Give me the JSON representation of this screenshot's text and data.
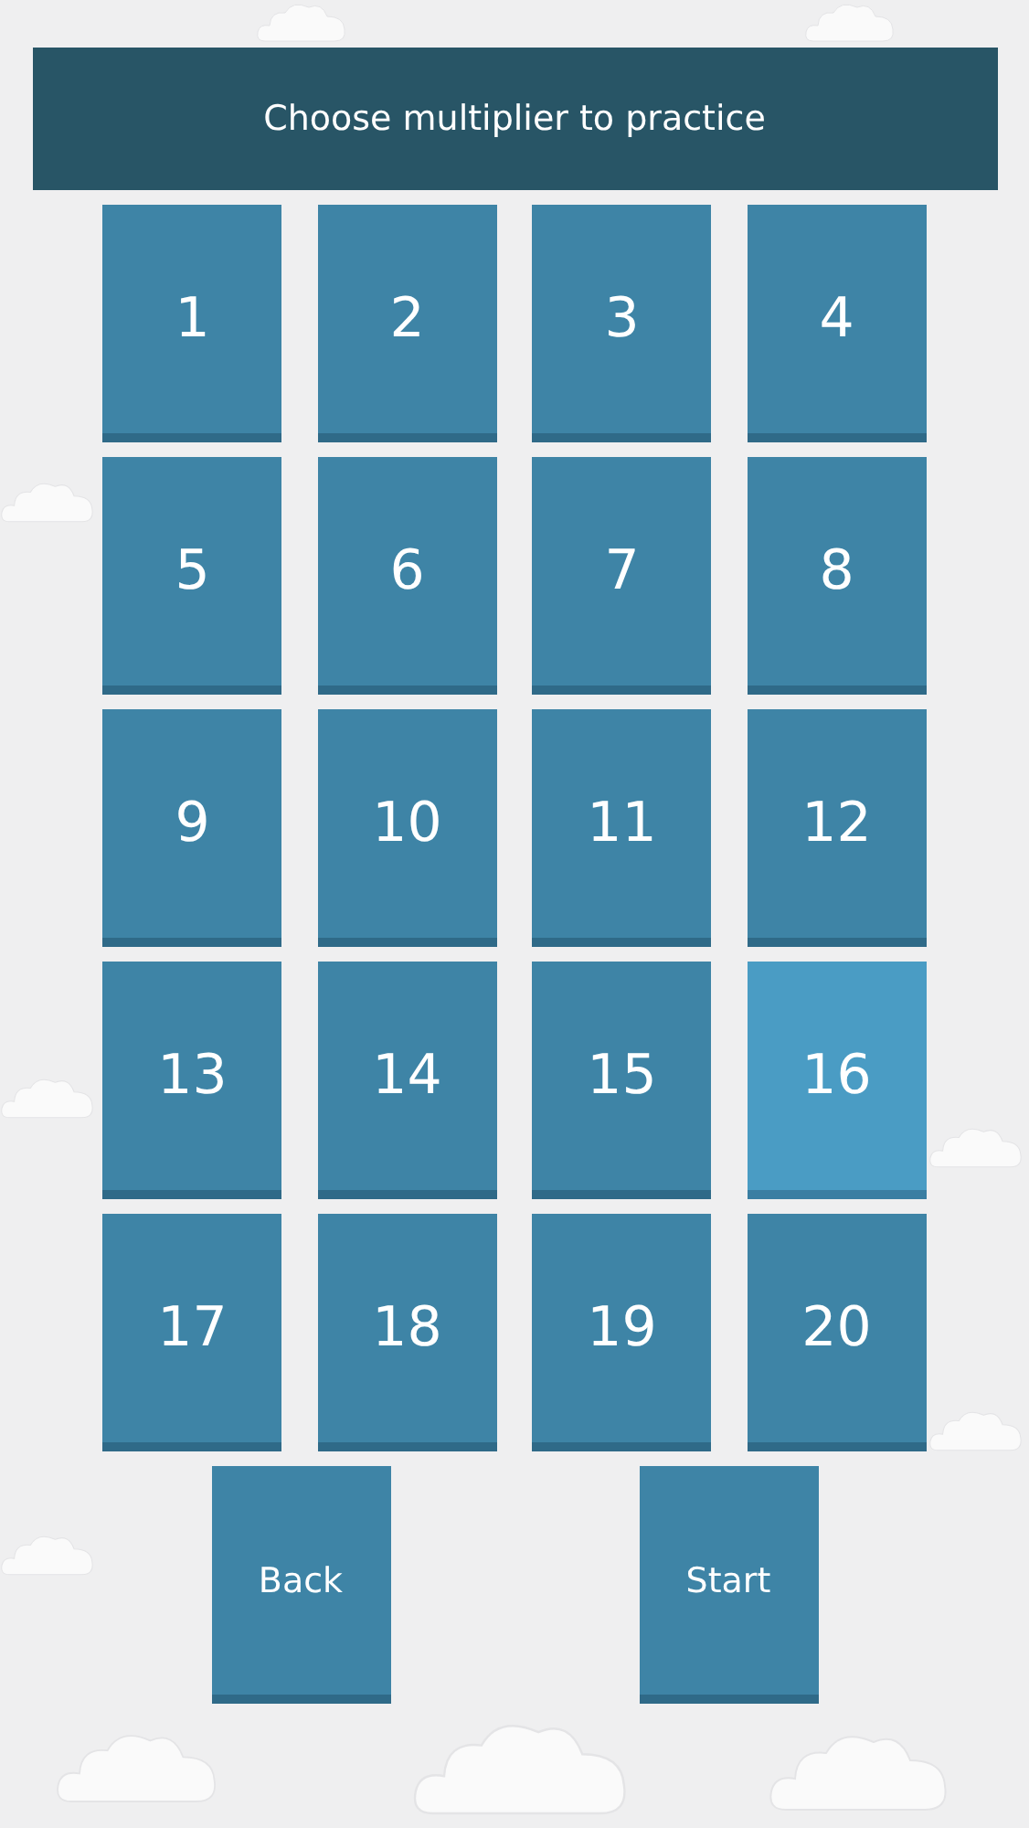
{
  "header": {
    "title": "Choose multiplier to practice"
  },
  "multipliers": [
    {
      "label": "1",
      "selected": false
    },
    {
      "label": "2",
      "selected": false
    },
    {
      "label": "3",
      "selected": false
    },
    {
      "label": "4",
      "selected": false
    },
    {
      "label": "5",
      "selected": false
    },
    {
      "label": "6",
      "selected": false
    },
    {
      "label": "7",
      "selected": false
    },
    {
      "label": "8",
      "selected": false
    },
    {
      "label": "9",
      "selected": false
    },
    {
      "label": "10",
      "selected": false
    },
    {
      "label": "11",
      "selected": false
    },
    {
      "label": "12",
      "selected": false
    },
    {
      "label": "13",
      "selected": false
    },
    {
      "label": "14",
      "selected": false
    },
    {
      "label": "15",
      "selected": false
    },
    {
      "label": "16",
      "selected": true
    },
    {
      "label": "17",
      "selected": false
    },
    {
      "label": "18",
      "selected": false
    },
    {
      "label": "19",
      "selected": false
    },
    {
      "label": "20",
      "selected": false
    }
  ],
  "buttons": [
    {
      "label": "Back"
    },
    {
      "label": "Start"
    }
  ]
}
